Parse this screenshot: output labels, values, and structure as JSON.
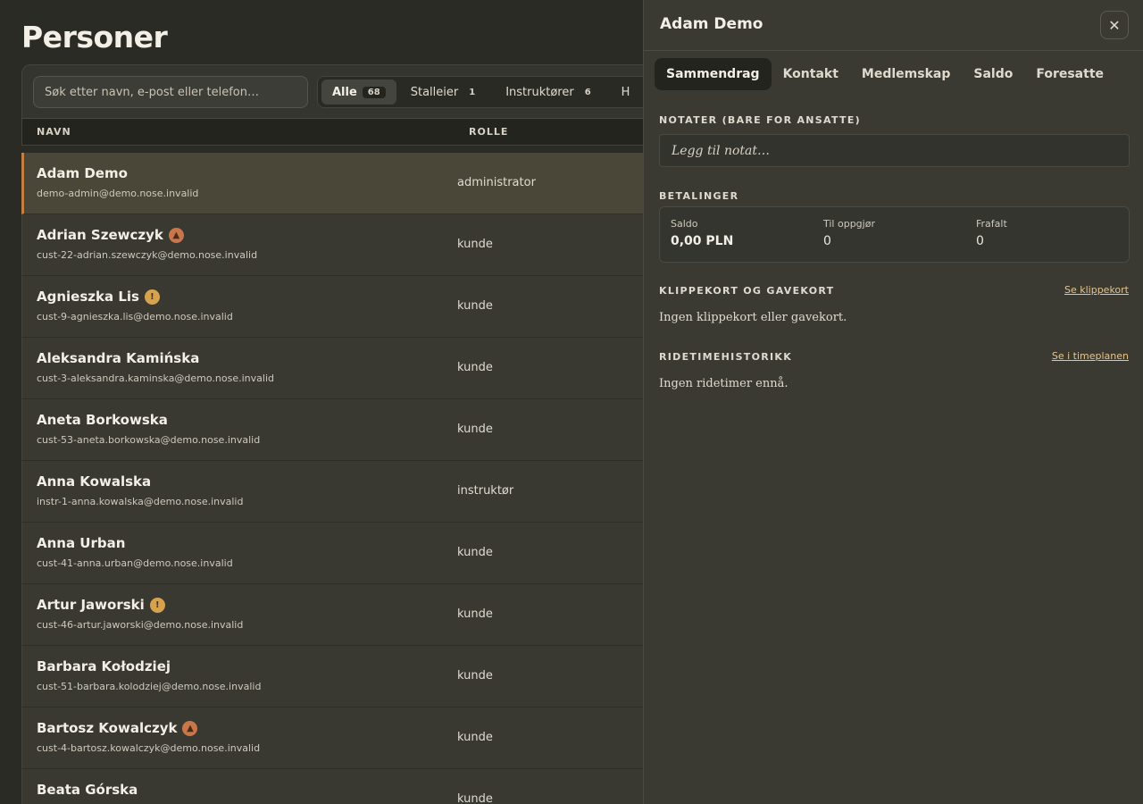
{
  "page": {
    "title": "Personer"
  },
  "search": {
    "placeholder": "Søk etter navn, e-post eller telefon…"
  },
  "filters": [
    {
      "label": "Alle",
      "count": "68",
      "active": true
    },
    {
      "label": "Stalleier",
      "count": "1"
    },
    {
      "label": "Instruktører",
      "count": "6"
    },
    {
      "label": "H"
    }
  ],
  "table": {
    "headers": {
      "name": "NAVN",
      "role": "ROLLE"
    },
    "rows": [
      {
        "name": "Adam Demo",
        "email": "demo-admin@demo.nose.invalid",
        "role": "administrator",
        "badge": "",
        "selected": true
      },
      {
        "name": "Adrian Szewczyk",
        "email": "cust-22-adrian.szewczyk@demo.nose.invalid",
        "role": "kunde",
        "badge": "warn"
      },
      {
        "name": "Agnieszka Lis",
        "email": "cust-9-agnieszka.lis@demo.nose.invalid",
        "role": "kunde",
        "badge": "info"
      },
      {
        "name": "Aleksandra Kamińska",
        "email": "cust-3-aleksandra.kaminska@demo.nose.invalid",
        "role": "kunde",
        "badge": ""
      },
      {
        "name": "Aneta Borkowska",
        "email": "cust-53-aneta.borkowska@demo.nose.invalid",
        "role": "kunde",
        "badge": ""
      },
      {
        "name": "Anna Kowalska",
        "email": "instr-1-anna.kowalska@demo.nose.invalid",
        "role": "instruktør",
        "badge": ""
      },
      {
        "name": "Anna Urban",
        "email": "cust-41-anna.urban@demo.nose.invalid",
        "role": "kunde",
        "badge": ""
      },
      {
        "name": "Artur Jaworski",
        "email": "cust-46-artur.jaworski@demo.nose.invalid",
        "role": "kunde",
        "badge": "info"
      },
      {
        "name": "Barbara Kołodziej",
        "email": "cust-51-barbara.kolodziej@demo.nose.invalid",
        "role": "kunde",
        "badge": ""
      },
      {
        "name": "Bartosz Kowalczyk",
        "email": "cust-4-bartosz.kowalczyk@demo.nose.invalid",
        "role": "kunde",
        "badge": "warn"
      },
      {
        "name": "Beata Górska",
        "email": "",
        "role": "kunde",
        "badge": ""
      }
    ]
  },
  "panel": {
    "title": "Adam Demo",
    "tabs": [
      "Sammendrag",
      "Kontakt",
      "Medlemskap",
      "Saldo",
      "Foresatte"
    ],
    "notes": {
      "label": "NOTATER (BARE FOR ANSATTE)",
      "placeholder": "Legg til notat…"
    },
    "payments": {
      "label": "BETALINGER",
      "saldo_label": "Saldo",
      "saldo_value": "0,00 PLN",
      "settle_label": "Til oppgjør",
      "settle_value": "0",
      "waived_label": "Frafalt",
      "waived_value": "0"
    },
    "cards": {
      "label": "KLIPPEKORT OG GAVEKORT",
      "link": "Se klippekort",
      "empty": "Ingen klippekort eller gavekort."
    },
    "history": {
      "label": "RIDETIMEHISTORIKK",
      "link": "Se i timeplanen",
      "empty": "Ingen ridetimer ennå."
    }
  }
}
